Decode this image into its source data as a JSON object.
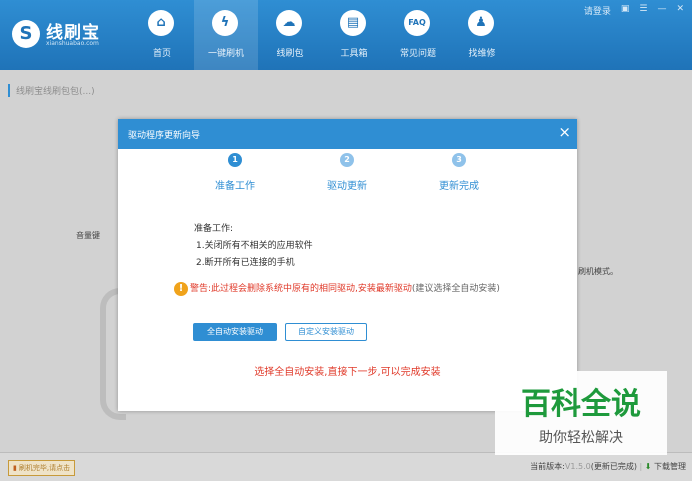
{
  "app": {
    "logo_mark": "S",
    "name": "线刷宝",
    "subtitle": "xianshuabao.com"
  },
  "nav": [
    {
      "label": "首页",
      "icon": "home-icon",
      "glyph": "⌂"
    },
    {
      "label": "一键刷机",
      "icon": "flash-icon",
      "glyph": "ϟ"
    },
    {
      "label": "线刷包",
      "icon": "package-icon",
      "glyph": "☁"
    },
    {
      "label": "工具箱",
      "icon": "toolbox-icon",
      "glyph": "▤"
    },
    {
      "label": "常见问题",
      "icon": "faq-icon",
      "glyph": "FAQ"
    },
    {
      "label": "找维修",
      "icon": "repair-icon",
      "glyph": "♟"
    }
  ],
  "window_controls": {
    "login": "请登录",
    "skin": "▣",
    "menu": "☰",
    "minimize": "—",
    "close": "✕"
  },
  "background": {
    "title": "线刷宝线刷包包(...)",
    "side_label": "音量键",
    "right_text": "刷机模式。"
  },
  "status": {
    "left": "刷机完毕,请点击",
    "version_label": "当前版本:",
    "version": "V1.5.0",
    "version_state": "(更新已完成)",
    "download": "下载管理"
  },
  "dialog": {
    "title": "驱动程序更新向导",
    "close": "×",
    "steps": [
      {
        "num": "1",
        "label": "准备工作"
      },
      {
        "num": "2",
        "label": "驱动更新"
      },
      {
        "num": "3",
        "label": "更新完成"
      }
    ],
    "prep_title": "准备工作:",
    "prep_items": [
      "1.关闭所有不相关的应用软件",
      "2.断开所有已连接的手机"
    ],
    "warning_icon": "!",
    "warning": "警告:此过程会删除系统中原有的相同驱动,安装最新驱动",
    "warning_tip": "(建议选择全自动安装)",
    "btn_auto": "全自动安装驱动",
    "btn_custom": "自定义安装驱动",
    "hint": "选择全自动安装,直接下一步,可以完成安装"
  },
  "watermark": {
    "title": "百科全说",
    "subtitle": "助你轻松解决"
  }
}
